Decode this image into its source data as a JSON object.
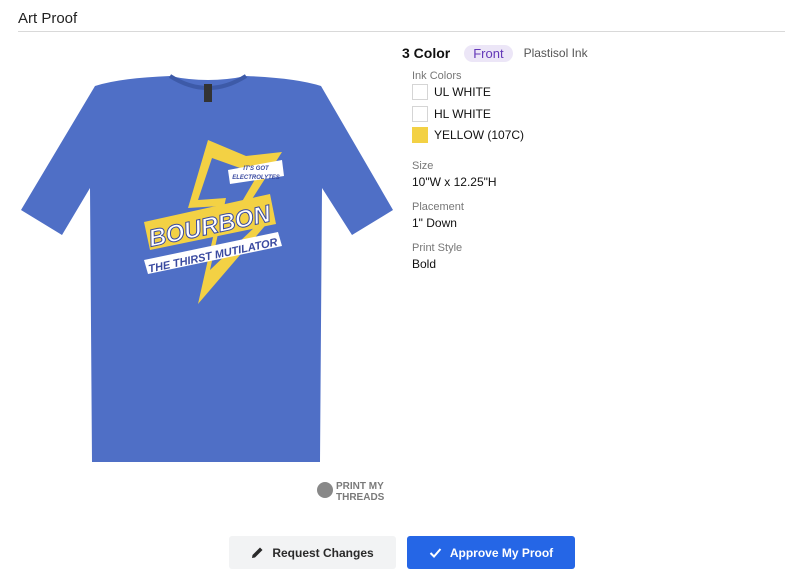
{
  "header": {
    "title": "Art Proof"
  },
  "proof": {
    "color_count": "3 Color",
    "location": "Front",
    "ink_type": "Plastisol Ink",
    "ink_colors_label": "Ink Colors",
    "ink_colors": [
      {
        "name": "UL WHITE",
        "hex": "#ffffff"
      },
      {
        "name": "HL WHITE",
        "hex": "#ffffff"
      },
      {
        "name": "YELLOW (107C)",
        "hex": "#f3d144"
      }
    ],
    "size_label": "Size",
    "size_value": "10\"W x 12.25\"H",
    "placement_label": "Placement",
    "placement_value": "1\" Down",
    "print_style_label": "Print Style",
    "print_style_value": "Bold"
  },
  "mockup": {
    "shirt_color": "#4f6fc6",
    "design_main": "BOURBON",
    "design_sub": "THE THIRST MUTILATOR",
    "design_tag_line1": "IT'S GOT",
    "design_tag_line2": "ELECTROLYTES",
    "watermark_line1": "PRINT MY",
    "watermark_line2": "THREADS"
  },
  "actions": {
    "request_label": "Request Changes",
    "approve_label": "Approve My Proof"
  },
  "colors": {
    "accent": "#2566e6",
    "pill_bg": "#ece6f7",
    "pill_text": "#6338b8",
    "design_yellow": "#f3d144"
  }
}
